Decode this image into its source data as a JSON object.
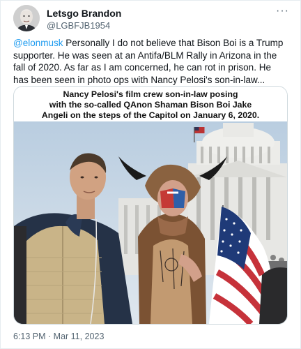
{
  "author": {
    "display_name": "Letsgo Brandon",
    "handle": "@LGBFJB1954"
  },
  "more_icon": "more-horizontal-icon",
  "tweet": {
    "mention": "@elonmusk",
    "text_lines": [
      " Personally I do not believe that Bison Boi is a Trump",
      "supporter. He was seen at an Antifa/BLM Rally in Arizona in the",
      "fall of 2020. As far as I am concerned, he can rot in prison. He",
      "has been seen in photo ops with Nancy Pelosi's son-in-law..."
    ]
  },
  "media": {
    "caption_lines": [
      "Nancy Pelosi's film crew son-in-law posing",
      "with the so-called QAnon Shaman Bison Boi Jake",
      "Angeli on the steps of the Capitol on January 6, 2020."
    ]
  },
  "timestamp": "6:13 PM · Mar 11, 2023",
  "colors": {
    "mention": "#1d9bf0",
    "secondary_text": "#536471",
    "border": "#cfd9de"
  }
}
